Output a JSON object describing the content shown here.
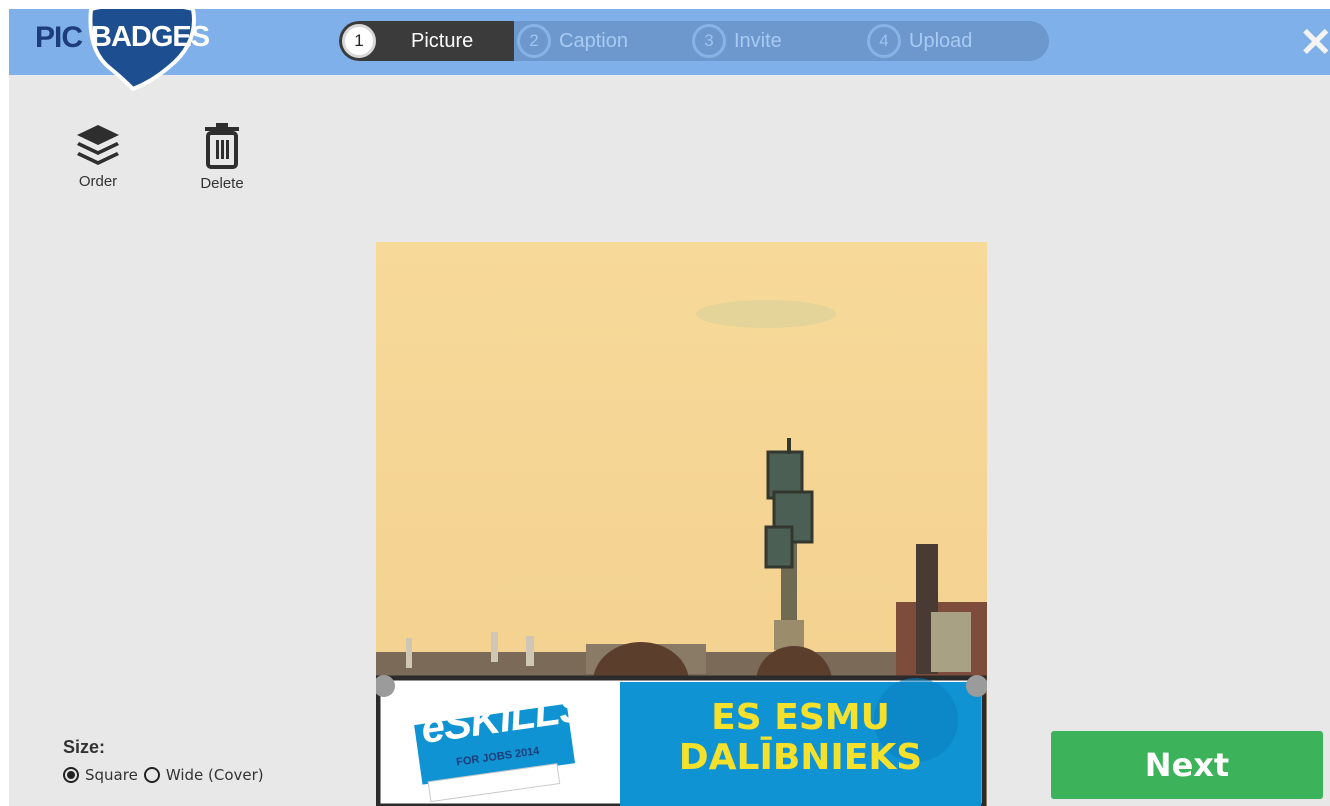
{
  "logo": {
    "left_word": "PIC",
    "right_word": "BADGES"
  },
  "steps": [
    {
      "num": "1",
      "label": "Picture"
    },
    {
      "num": "2",
      "label": "Caption"
    },
    {
      "num": "3",
      "label": "Invite"
    },
    {
      "num": "4",
      "label": "Upload"
    }
  ],
  "close_glyph": "✕",
  "tools": {
    "order_label": "Order",
    "delete_label": "Delete"
  },
  "badge": {
    "brand_main": "eSKILLS",
    "brand_sub": "FOR JOBS 2014",
    "line1": "ES ESMU",
    "line2": "DALĪBNIEKS"
  },
  "size": {
    "title": "Size:",
    "options": [
      "Square",
      "Wide (Cover)"
    ],
    "selected": "Square"
  },
  "next_label": "Next",
  "colors": {
    "topbar": "#7fb0ea",
    "active_step": "#3b3b3b",
    "next_button": "#3cb35a",
    "badge_blue": "#0f93d2",
    "badge_yellow": "#f5e12c"
  }
}
